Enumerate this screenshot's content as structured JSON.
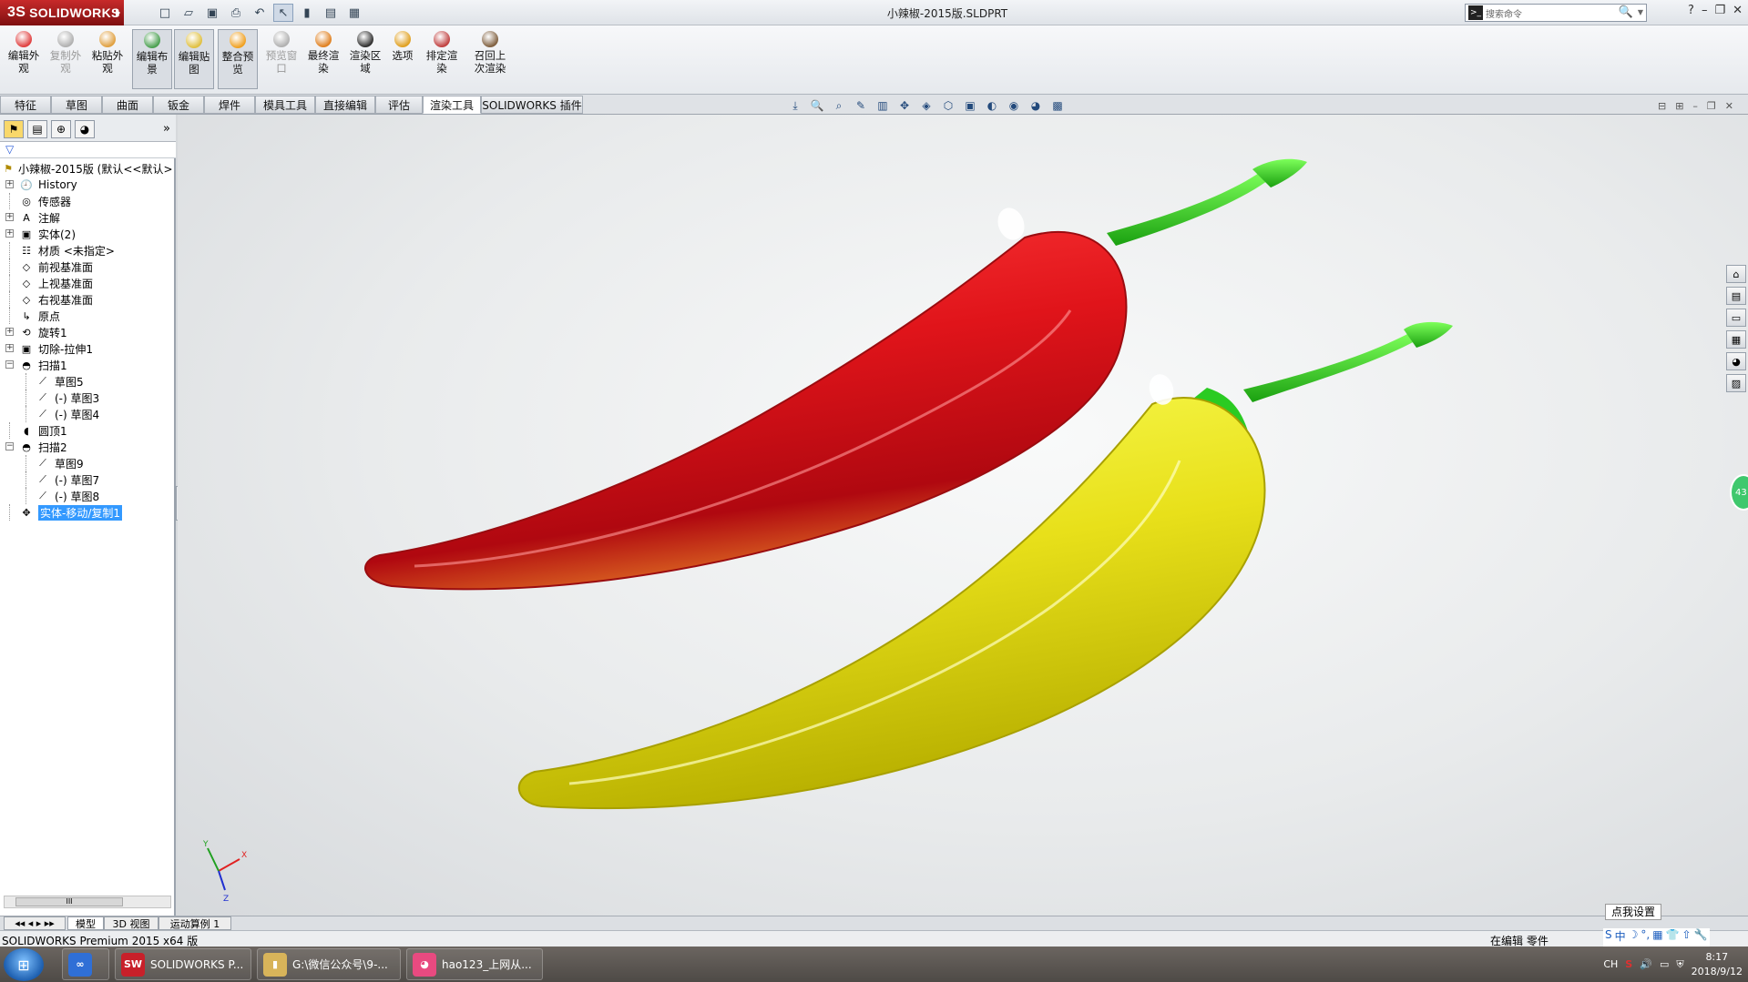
{
  "app": {
    "logo_text": "SOLIDWORKS",
    "logo_mark": "3S",
    "doc_title": "小辣椒-2015版.SLDPRT",
    "search_placeholder": "搜索命令",
    "search_cmd_glyph": ">_",
    "search_glyph": "🔍",
    "help_glyph": "?",
    "min_glyph": "–",
    "restore_glyph": "❐",
    "close_glyph": "✕"
  },
  "quick_access": [
    {
      "name": "new-doc-icon",
      "glyph": "□"
    },
    {
      "name": "open-icon",
      "glyph": "▱"
    },
    {
      "name": "save-icon",
      "glyph": "▣"
    },
    {
      "name": "print-icon",
      "glyph": "⎙"
    },
    {
      "name": "undo-icon",
      "glyph": "↶"
    },
    {
      "name": "select-icon",
      "glyph": "↖"
    },
    {
      "name": "rebuild-icon",
      "glyph": "▮"
    },
    {
      "name": "file-props-icon",
      "glyph": "▤"
    },
    {
      "name": "options-icon",
      "glyph": "▦"
    }
  ],
  "command_manager": [
    {
      "label": "编辑外\n观",
      "state": "normal",
      "color": "#e04040"
    },
    {
      "label": "复制外\n观",
      "state": "disabled",
      "color": "#b0b0b0"
    },
    {
      "label": "粘贴外\n观",
      "state": "normal",
      "color": "#e0a040"
    },
    {
      "label": "编辑布\n景",
      "state": "active",
      "color": "#4aa050"
    },
    {
      "label": "编辑贴\n图",
      "state": "active",
      "color": "#e0c040"
    },
    {
      "label": "整合预\n览",
      "state": "active",
      "color": "#f0a020"
    },
    {
      "label": "预览窗\n口",
      "state": "disabled",
      "color": "#b0b0b0"
    },
    {
      "label": "最终渲\n染",
      "state": "normal",
      "color": "#e08020"
    },
    {
      "label": "渲染区\n域",
      "state": "normal",
      "color": "#303030"
    },
    {
      "label": "选项",
      "state": "normal",
      "color": "#e0a020"
    },
    {
      "label": "排定渲\n染",
      "state": "normal",
      "color": "#c04040"
    },
    {
      "label": "召回上\n次渲染",
      "state": "normal",
      "color": "#806040"
    }
  ],
  "tabs": [
    "特征",
    "草图",
    "曲面",
    "钣金",
    "焊件",
    "模具工具",
    "直接编辑",
    "评估",
    "渲染工具",
    "SOLIDWORKS 插件"
  ],
  "active_tab": "渲染工具",
  "heads_up": [
    "⤓",
    "🔍",
    "⌕",
    "✎",
    "▥",
    "✥",
    "◈",
    "⬡",
    "▣",
    "◐",
    "◉",
    "◕",
    "▩"
  ],
  "view_ctrls": [
    "⊟",
    "⊞",
    "–",
    "❐",
    "✕"
  ],
  "feature_tree": {
    "filter_glyph": "▽",
    "expand_glyph": "»",
    "root": "小辣椒-2015版  (默认<<默认>",
    "items": [
      {
        "label": "History",
        "icon": "🕘",
        "indent": 1,
        "exp": "+"
      },
      {
        "label": "传感器",
        "icon": "◎",
        "indent": 1,
        "exp": ""
      },
      {
        "label": "注解",
        "icon": "A",
        "indent": 1,
        "exp": "+"
      },
      {
        "label": "实体(2)",
        "icon": "▣",
        "indent": 1,
        "exp": "+"
      },
      {
        "label": "材质 <未指定>",
        "icon": "☷",
        "indent": 1,
        "exp": ""
      },
      {
        "label": "前视基准面",
        "icon": "◇",
        "indent": 1,
        "exp": ""
      },
      {
        "label": "上视基准面",
        "icon": "◇",
        "indent": 1,
        "exp": ""
      },
      {
        "label": "右视基准面",
        "icon": "◇",
        "indent": 1,
        "exp": ""
      },
      {
        "label": "原点",
        "icon": "↳",
        "indent": 1,
        "exp": ""
      },
      {
        "label": "旋转1",
        "icon": "⟲",
        "indent": 1,
        "exp": "+"
      },
      {
        "label": "切除-拉伸1",
        "icon": "▣",
        "indent": 1,
        "exp": "+"
      },
      {
        "label": "扫描1",
        "icon": "◓",
        "indent": 1,
        "exp": "−"
      },
      {
        "label": "草图5",
        "icon": "⟋",
        "indent": 2,
        "exp": ""
      },
      {
        "label": "(-) 草图3",
        "icon": "⟋",
        "indent": 2,
        "exp": ""
      },
      {
        "label": "(-) 草图4",
        "icon": "⟋",
        "indent": 2,
        "exp": ""
      },
      {
        "label": "圆顶1",
        "icon": "◖",
        "indent": 1,
        "exp": ""
      },
      {
        "label": "扫描2",
        "icon": "◓",
        "indent": 1,
        "exp": "−"
      },
      {
        "label": "草图9",
        "icon": "⟋",
        "indent": 2,
        "exp": ""
      },
      {
        "label": "(-) 草图7",
        "icon": "⟋",
        "indent": 2,
        "exp": ""
      },
      {
        "label": "(-) 草图8",
        "icon": "⟋",
        "indent": 2,
        "exp": ""
      },
      {
        "label": "实体-移动/复制1",
        "icon": "✥",
        "indent": 1,
        "exp": "",
        "selected": true
      }
    ]
  },
  "scroll_thumb_glyph": "III",
  "triad": {
    "x": "X",
    "y": "Y",
    "z": "Z"
  },
  "taskpane": [
    "⌂",
    "▤",
    "▭",
    "▦",
    "◕",
    "▨"
  ],
  "badge_text": "43",
  "bottom_tabs": [
    "模型",
    "3D 视图",
    "运动算例 1"
  ],
  "active_bottom_tab": "模型",
  "status": {
    "left": "SOLIDWORKS Premium 2015 x64 版",
    "right": "在编辑 零件",
    "tooltip": "点我设置",
    "ime": [
      "S",
      "中",
      "☽",
      "°,",
      "▦",
      "👕",
      "⇧",
      "🔧"
    ]
  },
  "taskbar": {
    "start_glyph": "⊞",
    "items": [
      {
        "label": "",
        "icon_text": "∞",
        "color": "#2f6fd6"
      },
      {
        "label": "SOLIDWORKS P...",
        "icon_text": "SW",
        "color": "#c8202a"
      },
      {
        "label": "G:\\微信公众号\\9-...",
        "icon_text": "▮",
        "color": "#d8b45a"
      },
      {
        "label": "hao123_上网从...",
        "icon_text": "◕",
        "color": "#e84a80"
      }
    ],
    "tray": {
      "lang": "CH",
      "time": "8:17",
      "date": "2018/9/12"
    }
  },
  "colors": {
    "red_pepper": "#e0141a",
    "yellow_pepper": "#e8e01a",
    "stem": "#22c41a",
    "selection": "#3399ff"
  }
}
